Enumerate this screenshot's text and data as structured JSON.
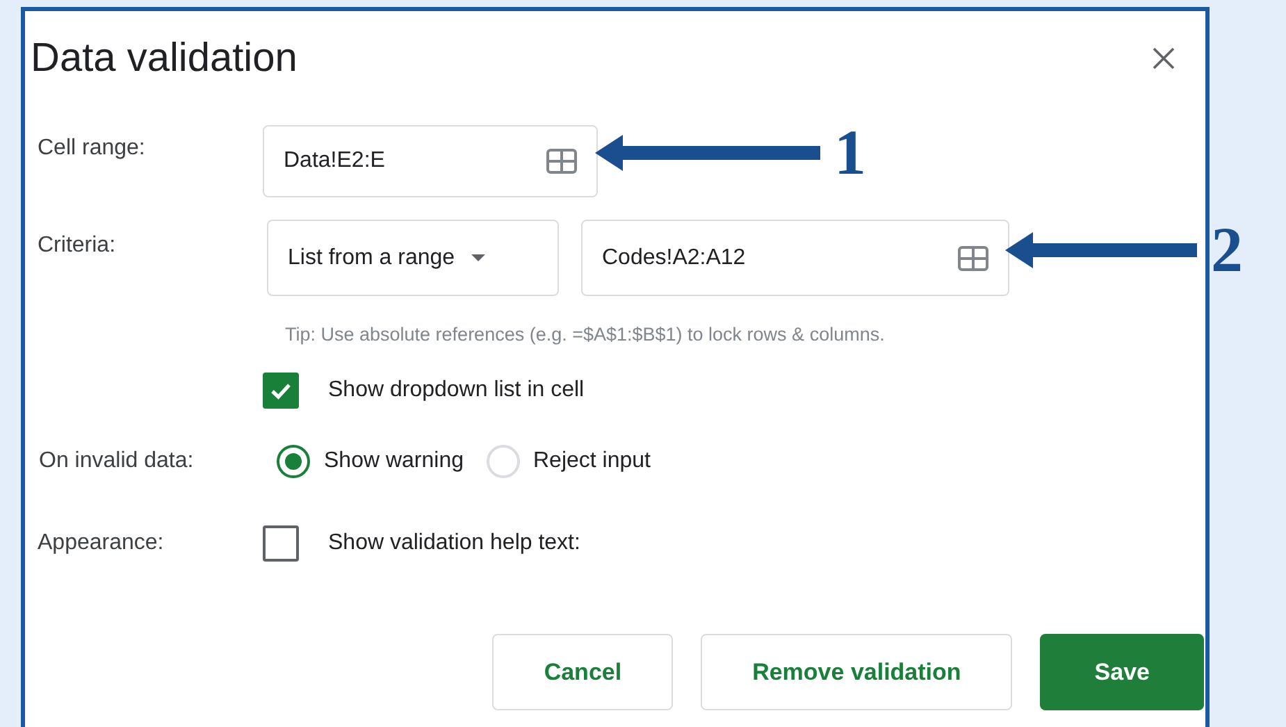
{
  "dialog": {
    "title": "Data validation",
    "cell_range": {
      "label": "Cell range:",
      "value": "Data!E2:E"
    },
    "criteria": {
      "label": "Criteria:",
      "dropdown": "List from a range",
      "value": "Codes!A2:A12",
      "tip": "Tip: Use absolute references (e.g. =$A$1:$B$1) to lock rows & columns."
    },
    "show_dropdown": {
      "label": "Show dropdown list in cell",
      "checked": true
    },
    "invalid_data": {
      "label": "On invalid data:",
      "options": [
        {
          "label": "Show warning",
          "selected": true
        },
        {
          "label": "Reject input",
          "selected": false
        }
      ]
    },
    "appearance": {
      "label": "Appearance:",
      "checkbox": {
        "label": "Show validation help text:",
        "checked": false
      }
    },
    "buttons": [
      {
        "label": "Cancel",
        "kind": "secondary"
      },
      {
        "label": "Remove validation",
        "kind": "secondary"
      },
      {
        "label": "Save",
        "kind": "primary"
      }
    ]
  },
  "annotations": [
    {
      "number": "1"
    },
    {
      "number": "2"
    }
  ]
}
